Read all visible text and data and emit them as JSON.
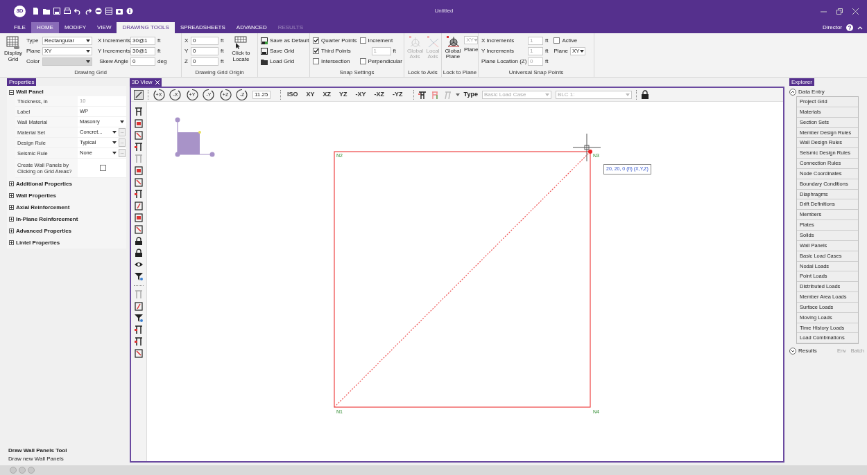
{
  "app": {
    "logo": "3D",
    "title": "Untitled",
    "user": "Director"
  },
  "menu_tabs": [
    {
      "label": "FILE",
      "selected": false,
      "highlighted": false,
      "disabled": false
    },
    {
      "label": "HOME",
      "selected": false,
      "highlighted": true,
      "disabled": false
    },
    {
      "label": "MODIFY",
      "selected": false,
      "highlighted": false,
      "disabled": false
    },
    {
      "label": "VIEW",
      "selected": false,
      "highlighted": false,
      "disabled": false
    },
    {
      "label": "DRAWING TOOLS",
      "selected": true,
      "highlighted": false,
      "disabled": false
    },
    {
      "label": "SPREADSHEETS",
      "selected": false,
      "highlighted": false,
      "disabled": false
    },
    {
      "label": "ADVANCED",
      "selected": false,
      "highlighted": false,
      "disabled": false
    },
    {
      "label": "RESULTS",
      "selected": false,
      "highlighted": false,
      "disabled": true
    }
  ],
  "ribbon": {
    "drawing_grid": {
      "display_button": "Display Grid",
      "type_label": "Type",
      "type_value": "Rectangular",
      "plane_label": "Plane",
      "plane_value": "XY",
      "color_label": "Color",
      "x_label": "X Increments",
      "x_value": "30@1",
      "x_unit": "ft",
      "y_label": "Y Increments",
      "y_value": "30@1",
      "y_unit": "ft",
      "skew_label": "Skew Angle",
      "skew_value": "0",
      "skew_unit": "deg",
      "group_label": "Drawing Grid"
    },
    "grid_origin": {
      "fields": [
        {
          "label": "X",
          "value": "0",
          "unit": "ft"
        },
        {
          "label": "Y",
          "value": "0",
          "unit": "ft"
        },
        {
          "label": "Z",
          "value": "0",
          "unit": "ft"
        }
      ],
      "locate_button": "Click to Locate",
      "group_label": "Drawing Grid Origin"
    },
    "grid_file": {
      "buttons": [
        "Save as Default",
        "Save Grid",
        "Load Grid"
      ]
    },
    "snap": {
      "options": [
        {
          "label": "Quarter Points",
          "checked": true
        },
        {
          "label": "Third Points",
          "checked": true
        },
        {
          "label": "Intersection",
          "checked": false
        },
        {
          "label": "Increment",
          "checked": false
        },
        {
          "label": "Perpendicular",
          "checked": false
        }
      ],
      "increment_value": "1",
      "increment_unit": "ft",
      "group_label": "Snap Settings"
    },
    "lock_axis": {
      "buttons": [
        {
          "label": "Global Axis",
          "disabled": true
        },
        {
          "label": "Local Axis",
          "disabled": true
        }
      ],
      "group_label": "Lock to Axis"
    },
    "lock_plane": {
      "button": "Global Plane",
      "plane_label": "Plane",
      "plane_value": "XY",
      "group_label": "Lock to Plane"
    },
    "universal": {
      "x_label": "X Increments",
      "x_value": "1",
      "x_unit": "ft",
      "y_label": "Y Increments",
      "y_value": "1",
      "y_unit": "ft",
      "z_label": "Plane Location (Z)",
      "z_value": "0",
      "z_unit": "ft",
      "active_label": "Active",
      "active_checked": false,
      "plane_label": "Plane",
      "plane_value": "XY",
      "group_label": "Universal Snap Points"
    }
  },
  "properties": {
    "title": "Properties",
    "section": "Wall Panel",
    "expanded": true,
    "more_label": "...",
    "rows": [
      {
        "kind": "readonly",
        "label": "Thickness, in",
        "value": "10"
      },
      {
        "kind": "text",
        "label": "Label",
        "value": "WP"
      },
      {
        "kind": "dropdown",
        "label": "Wall Material",
        "value": "Masonry"
      },
      {
        "kind": "dropdown_more",
        "label": "Material Set",
        "value": "Concret..."
      },
      {
        "kind": "dropdown_more",
        "label": "Design Rule",
        "value": "Typical"
      },
      {
        "kind": "dropdown_more",
        "label": "Seismic Rule",
        "value": "None"
      },
      {
        "kind": "checkbox",
        "label": "Create Wall Panels by Clicking on Grid Areas?",
        "checked": false
      }
    ],
    "groups": [
      {
        "label": "Additional Properties",
        "expanded": false
      },
      {
        "label": "Wall Properties",
        "expanded": false
      },
      {
        "label": "Axial Reinforcement",
        "expanded": false
      },
      {
        "label": "In-Plane Reinforcement",
        "expanded": false
      },
      {
        "label": "Advanced Properties",
        "expanded": false
      },
      {
        "label": "Lintel Properties",
        "expanded": false
      }
    ]
  },
  "view": {
    "tab": "3D View",
    "rotate": [
      "+X",
      "-X",
      "+Y",
      "-Y",
      "+Z",
      "-Z"
    ],
    "angle": "11.25",
    "views": [
      "ISO",
      "XY",
      "XZ",
      "YZ",
      "-XY",
      "-XZ",
      "-YZ"
    ],
    "type_label": "Type",
    "load_type": "Basic Load Case",
    "load_case": "BLC 1:"
  },
  "drawing": {
    "nodes": [
      {
        "label": "N2"
      },
      {
        "label": "N3"
      },
      {
        "label": "N1"
      },
      {
        "label": "N4"
      }
    ],
    "tooltip": "20, 20, 0 (ft) (X,Y,Z)"
  },
  "explorer": {
    "title": "Explorer",
    "data_entry": {
      "label": "Data Entry",
      "expanded": true
    },
    "items": [
      "Project Grid",
      "Materials",
      "Section Sets",
      "Member Design Rules",
      "Wall Design Rules",
      "Seismic Design Rules",
      "Connection Rules",
      "Node Coordinates",
      "Boundary Conditions",
      "Diaphragms",
      "Drift Definitions",
      "Members",
      "Plates",
      "Solids",
      "Wall Panels",
      "Basic Load Cases",
      "Nodal Loads",
      "Point Loads",
      "Distributed Loads",
      "Member Area Loads",
      "Surface Loads",
      "Moving Loads",
      "Time History Loads",
      "Load Combinations"
    ],
    "results": {
      "label": "Results",
      "expanded": false
    },
    "links": [
      "Env",
      "Batch"
    ]
  },
  "status": {
    "tool": "Draw Wall Panels Tool",
    "hint": "Draw new Wall Panels"
  }
}
